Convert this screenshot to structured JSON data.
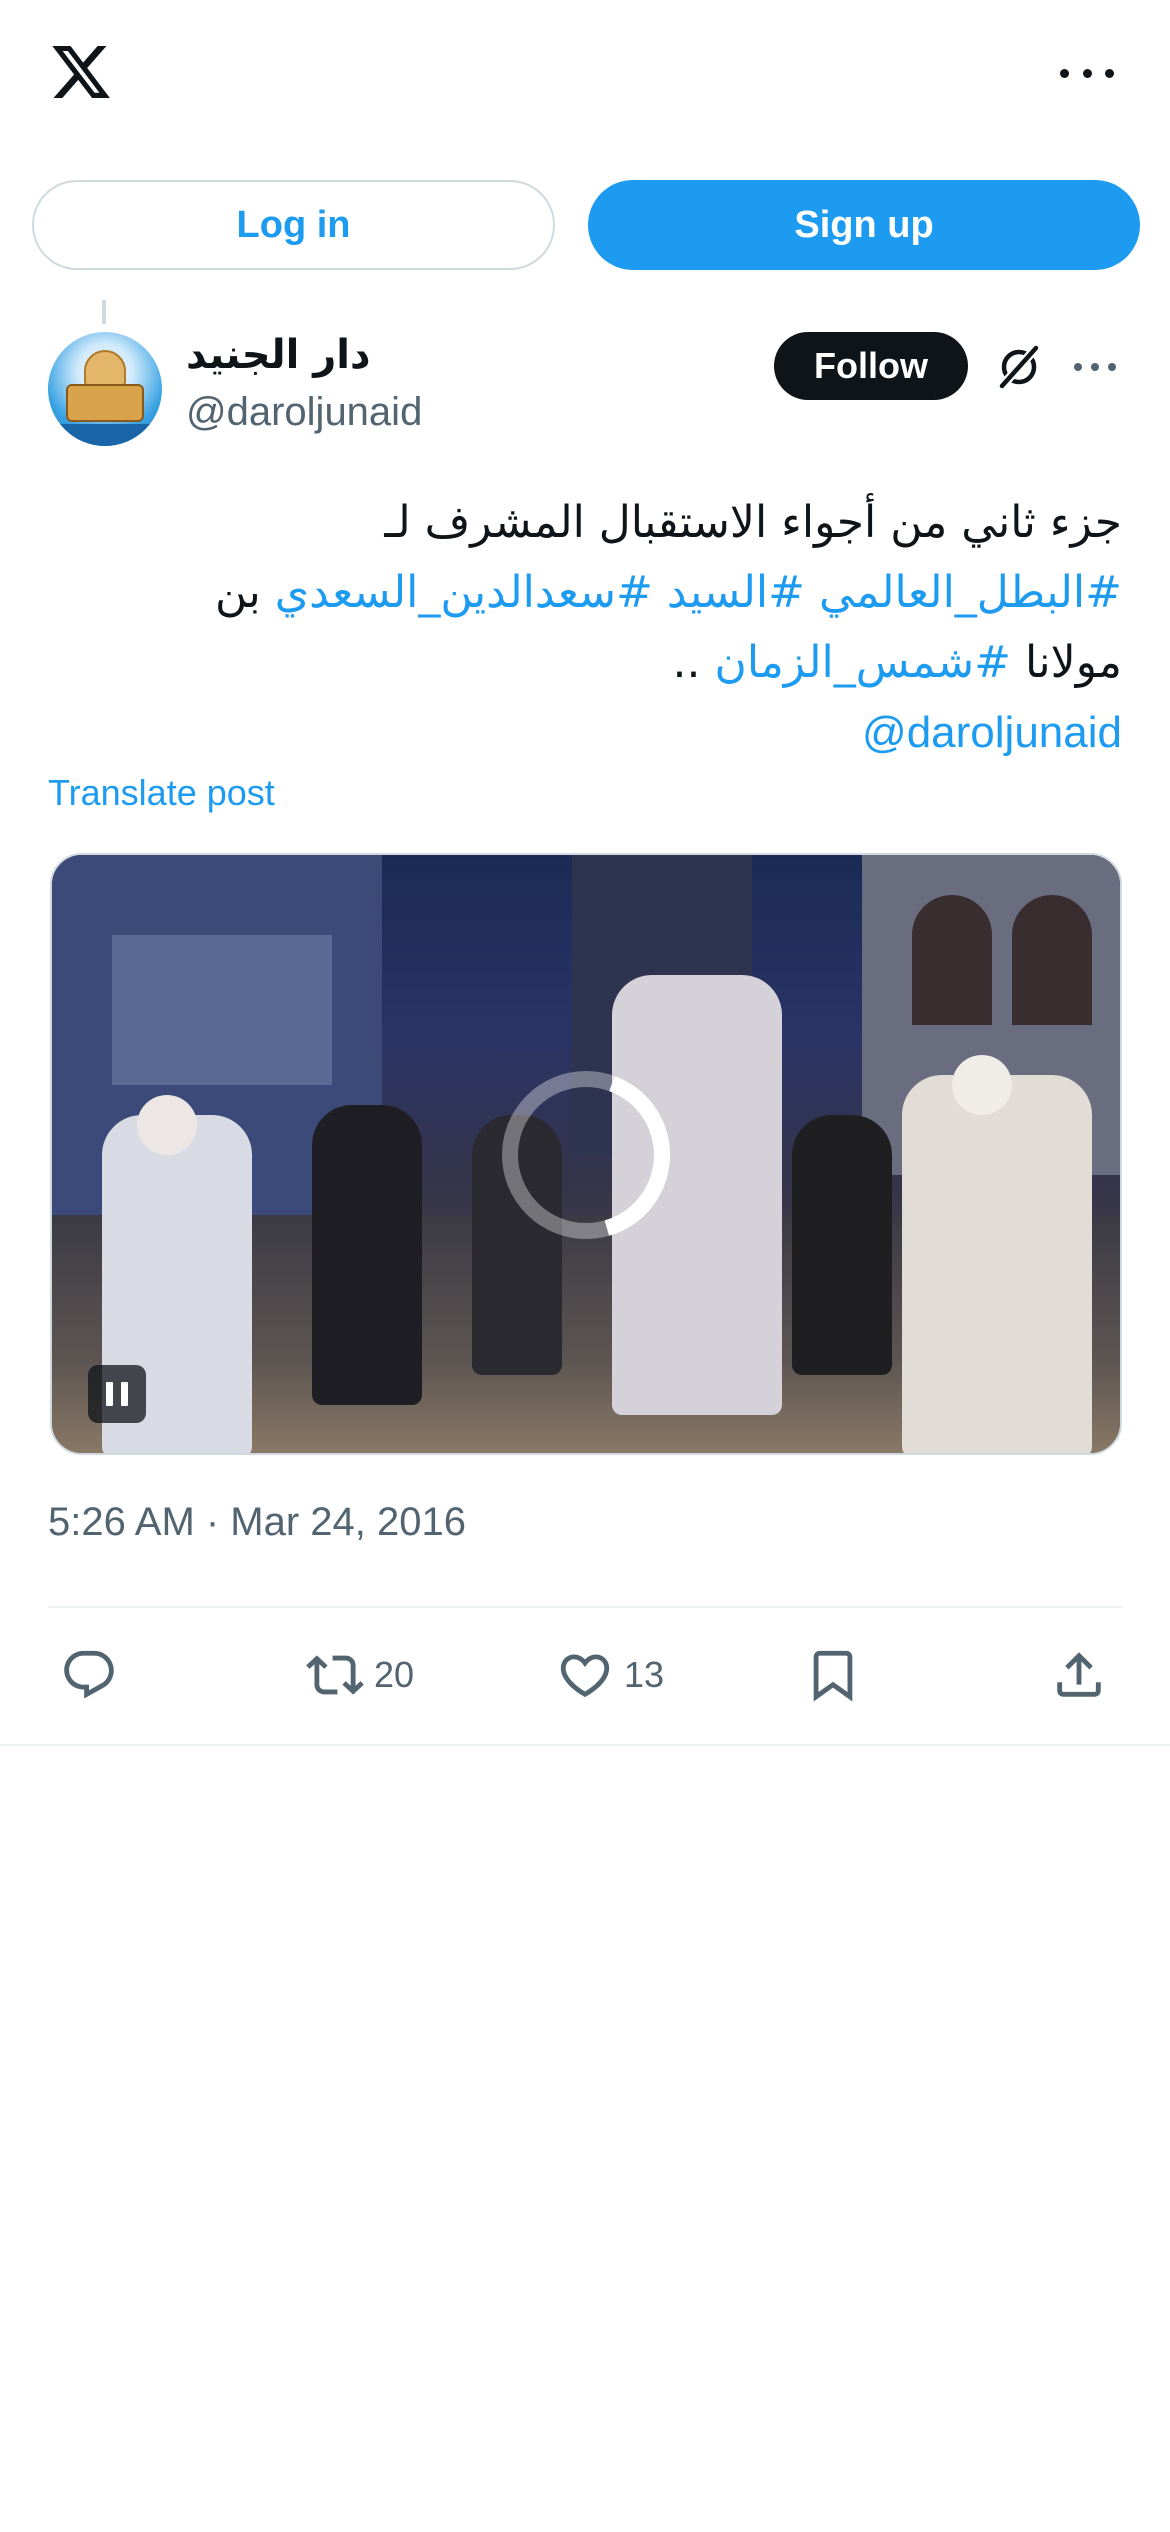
{
  "topbar": {
    "logo_icon": "x-logo-icon",
    "more_icon": "more-horizontal-icon"
  },
  "auth": {
    "login_label": "Log in",
    "signup_label": "Sign up"
  },
  "post": {
    "author_name": "دار الجنيد",
    "author_handle": "@daroljunaid",
    "follow_label": "Follow",
    "text_lines": [
      [
        {
          "text": "جزء ثاني من أجواء الاستقبال المشرف لـ",
          "link": false
        }
      ],
      [
        {
          "text": "#البطل_العالمي",
          "link": true
        },
        {
          "text": " ",
          "link": false
        },
        {
          "text": "#السيد",
          "link": true
        },
        {
          "text": " ",
          "link": false
        },
        {
          "text": "#سعدالدين_السعدي",
          "link": true
        },
        {
          "text": " بن",
          "link": false
        }
      ],
      [
        {
          "text": "مولانا ",
          "link": false
        },
        {
          "text": "#شمس_الزمان",
          "link": true
        },
        {
          "text": " ..",
          "link": false
        }
      ],
      [
        {
          "text": "@daroljunaid",
          "link": true,
          "mention": true
        }
      ]
    ],
    "translate_label": "Translate post",
    "timestamp": "5:26 AM · Mar 24, 2016",
    "actions": {
      "reply": {
        "icon": "reply-icon",
        "count": ""
      },
      "retweet": {
        "icon": "retweet-icon",
        "count": "20"
      },
      "like": {
        "icon": "heart-icon",
        "count": "13"
      },
      "bookmark": {
        "icon": "bookmark-icon",
        "count": ""
      },
      "share": {
        "icon": "share-icon",
        "count": ""
      }
    }
  },
  "video": {
    "state": "playing",
    "control_icon": "pause-icon",
    "loading_icon": "spinner-icon",
    "loading_progress": 0.4
  },
  "colors": {
    "accent": "#1d9bf0",
    "text": "#0f1419",
    "secondary": "#536471",
    "border": "#cfd9de"
  }
}
